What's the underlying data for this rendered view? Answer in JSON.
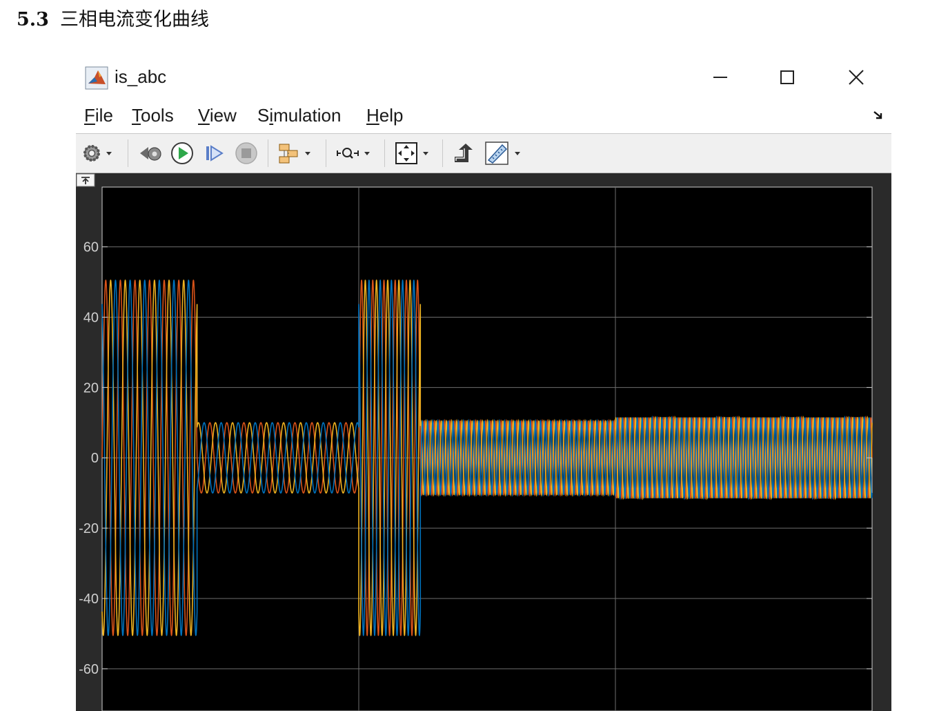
{
  "heading": {
    "number": "5.3",
    "title": "三相电流变化曲线"
  },
  "window": {
    "title": "is_abc",
    "controls": [
      "minimize-icon",
      "maximize-icon",
      "close-icon"
    ]
  },
  "menu": [
    {
      "label": "File"
    },
    {
      "label": "Tools"
    },
    {
      "label": "View"
    },
    {
      "label": "Simulation"
    },
    {
      "label": "Help"
    }
  ],
  "toolbar": {
    "icons": [
      "gear-icon",
      "step-back-icon",
      "run-icon",
      "step-forward-icon",
      "stop-icon",
      "signal-selector-icon",
      "zoom-icon",
      "autoscale-icon",
      "highlight-block-icon",
      "measurements-icon"
    ]
  },
  "colors": {
    "phase_a": "#d95319",
    "phase_b": "#edb120",
    "phase_c": "#0072bd",
    "plot_background": "#000000",
    "frame_background": "#2a2a2a"
  },
  "chart_data": {
    "type": "line",
    "title": "",
    "xlabel": "",
    "ylabel": "",
    "ylim": [
      -72,
      77
    ],
    "xlim": [
      0,
      3
    ],
    "grid": true,
    "yticks": [
      60,
      40,
      20,
      0,
      -20,
      -40,
      -60
    ],
    "series": [
      {
        "phase": "a",
        "phase_offset_deg": 0
      },
      {
        "phase": "b",
        "phase_offset_deg": -120
      },
      {
        "phase": "c",
        "phase_offset_deg": 120
      }
    ],
    "segments": [
      {
        "t_start": 0.0,
        "t_end": 0.37,
        "amplitude": 50.5,
        "cycles": 6.5
      },
      {
        "t_start": 0.37,
        "t_end": 1.0,
        "amplitude": 10.0,
        "cycles": 9.5
      },
      {
        "t_start": 1.0,
        "t_end": 1.24,
        "amplitude": 50.5,
        "cycles": 5.5
      },
      {
        "t_start": 1.24,
        "t_end": 2.0,
        "amplitude": 10.5,
        "cycles": 38
      },
      {
        "t_start": 2.0,
        "t_end": 3.0,
        "amplitude": 11.5,
        "cycles": 52
      }
    ]
  }
}
